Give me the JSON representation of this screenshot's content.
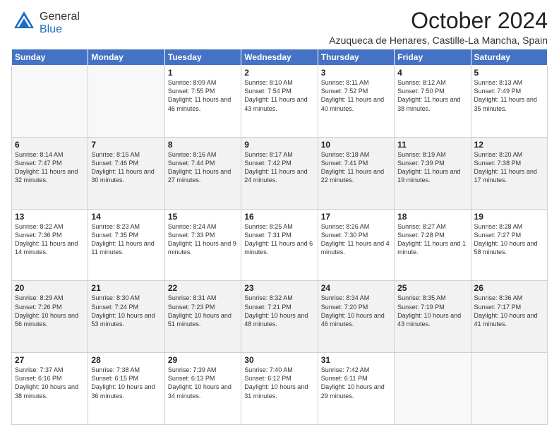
{
  "header": {
    "logo_general": "General",
    "logo_blue": "Blue",
    "month": "October 2024",
    "location": "Azuqueca de Henares, Castille-La Mancha, Spain"
  },
  "weekdays": [
    "Sunday",
    "Monday",
    "Tuesday",
    "Wednesday",
    "Thursday",
    "Friday",
    "Saturday"
  ],
  "weeks": [
    [
      {
        "day": "",
        "info": ""
      },
      {
        "day": "",
        "info": ""
      },
      {
        "day": "1",
        "info": "Sunrise: 8:09 AM\nSunset: 7:55 PM\nDaylight: 11 hours and 46 minutes."
      },
      {
        "day": "2",
        "info": "Sunrise: 8:10 AM\nSunset: 7:54 PM\nDaylight: 11 hours and 43 minutes."
      },
      {
        "day": "3",
        "info": "Sunrise: 8:11 AM\nSunset: 7:52 PM\nDaylight: 11 hours and 40 minutes."
      },
      {
        "day": "4",
        "info": "Sunrise: 8:12 AM\nSunset: 7:50 PM\nDaylight: 11 hours and 38 minutes."
      },
      {
        "day": "5",
        "info": "Sunrise: 8:13 AM\nSunset: 7:49 PM\nDaylight: 11 hours and 35 minutes."
      }
    ],
    [
      {
        "day": "6",
        "info": "Sunrise: 8:14 AM\nSunset: 7:47 PM\nDaylight: 11 hours and 32 minutes."
      },
      {
        "day": "7",
        "info": "Sunrise: 8:15 AM\nSunset: 7:46 PM\nDaylight: 11 hours and 30 minutes."
      },
      {
        "day": "8",
        "info": "Sunrise: 8:16 AM\nSunset: 7:44 PM\nDaylight: 11 hours and 27 minutes."
      },
      {
        "day": "9",
        "info": "Sunrise: 8:17 AM\nSunset: 7:42 PM\nDaylight: 11 hours and 24 minutes."
      },
      {
        "day": "10",
        "info": "Sunrise: 8:18 AM\nSunset: 7:41 PM\nDaylight: 11 hours and 22 minutes."
      },
      {
        "day": "11",
        "info": "Sunrise: 8:19 AM\nSunset: 7:39 PM\nDaylight: 11 hours and 19 minutes."
      },
      {
        "day": "12",
        "info": "Sunrise: 8:20 AM\nSunset: 7:38 PM\nDaylight: 11 hours and 17 minutes."
      }
    ],
    [
      {
        "day": "13",
        "info": "Sunrise: 8:22 AM\nSunset: 7:36 PM\nDaylight: 11 hours and 14 minutes."
      },
      {
        "day": "14",
        "info": "Sunrise: 8:23 AM\nSunset: 7:35 PM\nDaylight: 11 hours and 11 minutes."
      },
      {
        "day": "15",
        "info": "Sunrise: 8:24 AM\nSunset: 7:33 PM\nDaylight: 11 hours and 9 minutes."
      },
      {
        "day": "16",
        "info": "Sunrise: 8:25 AM\nSunset: 7:31 PM\nDaylight: 11 hours and 6 minutes."
      },
      {
        "day": "17",
        "info": "Sunrise: 8:26 AM\nSunset: 7:30 PM\nDaylight: 11 hours and 4 minutes."
      },
      {
        "day": "18",
        "info": "Sunrise: 8:27 AM\nSunset: 7:28 PM\nDaylight: 11 hours and 1 minute."
      },
      {
        "day": "19",
        "info": "Sunrise: 8:28 AM\nSunset: 7:27 PM\nDaylight: 10 hours and 58 minutes."
      }
    ],
    [
      {
        "day": "20",
        "info": "Sunrise: 8:29 AM\nSunset: 7:26 PM\nDaylight: 10 hours and 56 minutes."
      },
      {
        "day": "21",
        "info": "Sunrise: 8:30 AM\nSunset: 7:24 PM\nDaylight: 10 hours and 53 minutes."
      },
      {
        "day": "22",
        "info": "Sunrise: 8:31 AM\nSunset: 7:23 PM\nDaylight: 10 hours and 51 minutes."
      },
      {
        "day": "23",
        "info": "Sunrise: 8:32 AM\nSunset: 7:21 PM\nDaylight: 10 hours and 48 minutes."
      },
      {
        "day": "24",
        "info": "Sunrise: 8:34 AM\nSunset: 7:20 PM\nDaylight: 10 hours and 46 minutes."
      },
      {
        "day": "25",
        "info": "Sunrise: 8:35 AM\nSunset: 7:19 PM\nDaylight: 10 hours and 43 minutes."
      },
      {
        "day": "26",
        "info": "Sunrise: 8:36 AM\nSunset: 7:17 PM\nDaylight: 10 hours and 41 minutes."
      }
    ],
    [
      {
        "day": "27",
        "info": "Sunrise: 7:37 AM\nSunset: 6:16 PM\nDaylight: 10 hours and 38 minutes."
      },
      {
        "day": "28",
        "info": "Sunrise: 7:38 AM\nSunset: 6:15 PM\nDaylight: 10 hours and 36 minutes."
      },
      {
        "day": "29",
        "info": "Sunrise: 7:39 AM\nSunset: 6:13 PM\nDaylight: 10 hours and 34 minutes."
      },
      {
        "day": "30",
        "info": "Sunrise: 7:40 AM\nSunset: 6:12 PM\nDaylight: 10 hours and 31 minutes."
      },
      {
        "day": "31",
        "info": "Sunrise: 7:42 AM\nSunset: 6:11 PM\nDaylight: 10 hours and 29 minutes."
      },
      {
        "day": "",
        "info": ""
      },
      {
        "day": "",
        "info": ""
      }
    ]
  ]
}
